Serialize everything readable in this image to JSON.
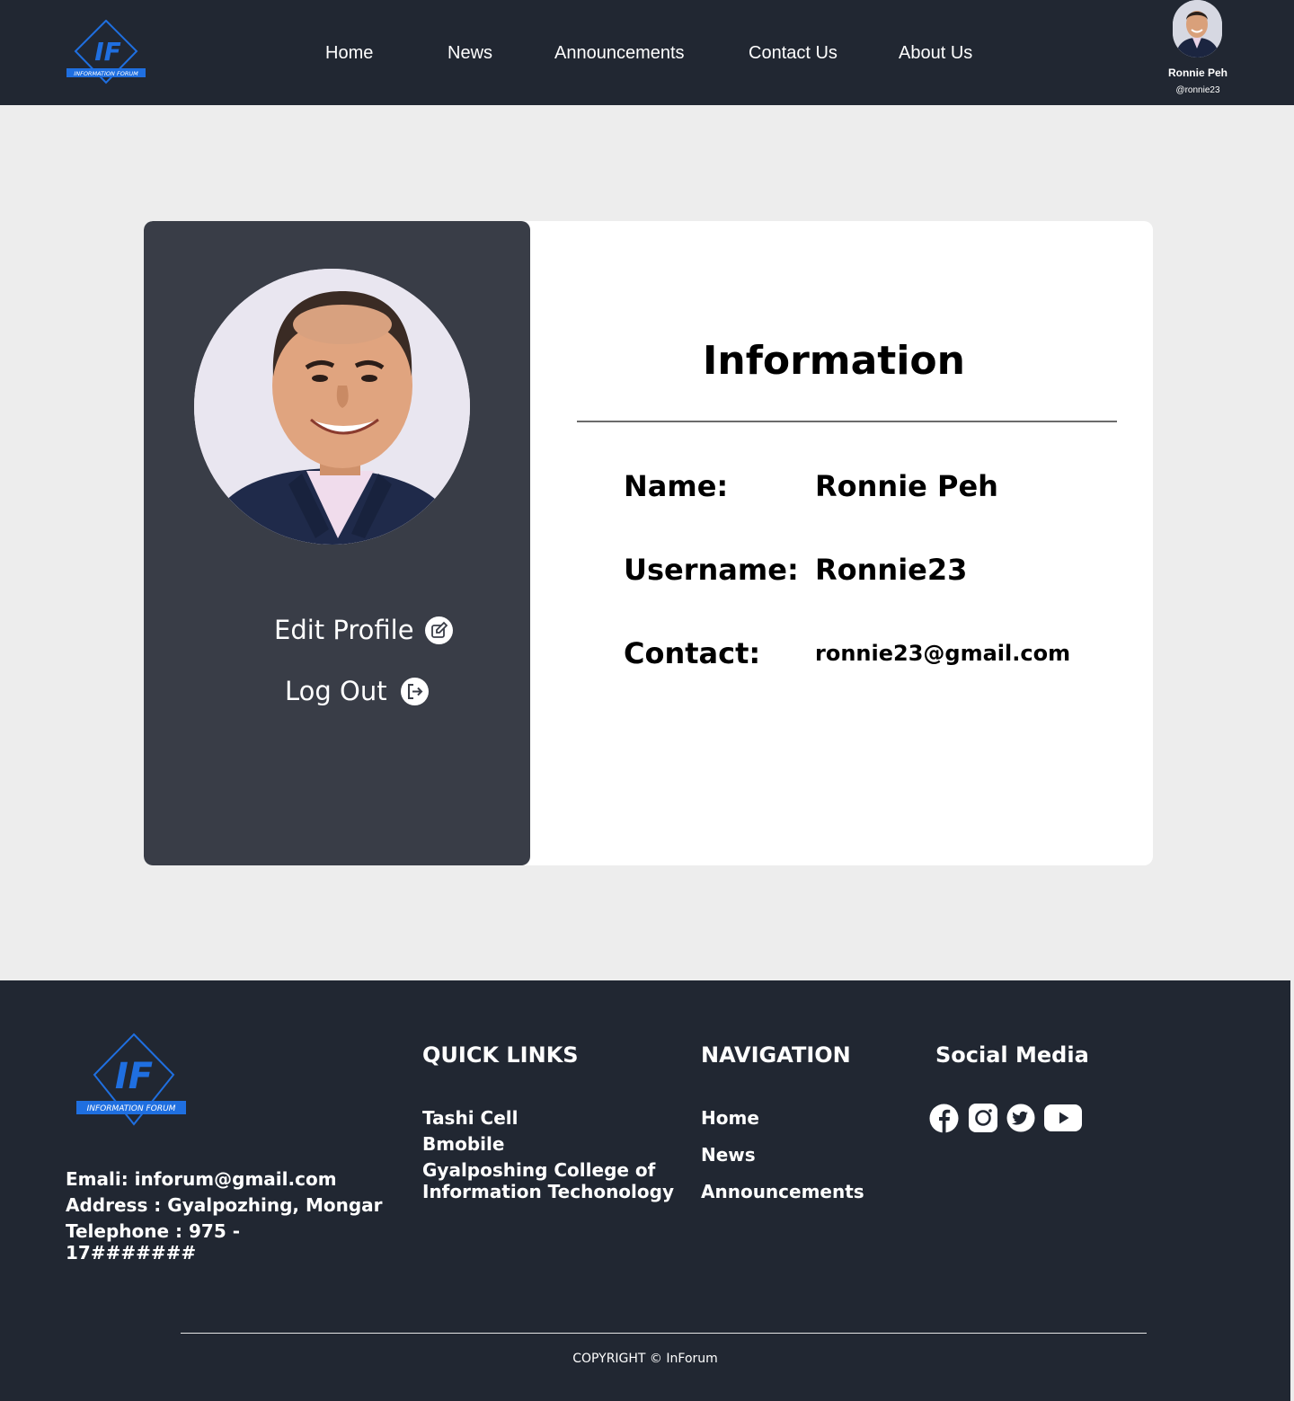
{
  "header": {
    "logo_text": "INFORMATION FORUM",
    "logo_monogram": "IF",
    "nav": [
      "Home",
      "News",
      "Announcements",
      "Contact Us",
      "About Us"
    ],
    "user": {
      "name": "Ronnie Peh",
      "handle": "@ronnie23"
    }
  },
  "profile": {
    "actions": {
      "edit": "Edit Profile",
      "logout": "Log Out"
    },
    "info_title": "Information",
    "fields": [
      {
        "label": "Name:",
        "value": "Ronnie Peh"
      },
      {
        "label": "Username:",
        "value": "Ronnie23"
      },
      {
        "label": "Contact:",
        "value": "ronnie23@gmail.com"
      }
    ]
  },
  "footer": {
    "logo_text": "INFORMATION FORUM",
    "logo_monogram": "IF",
    "contact": {
      "email": "Emali:  inforum@gmail.com",
      "address": "Address : Gyalpozhing, Mongar",
      "telephone_line1": "Telephone : 975 -",
      "telephone_line2": "17#######"
    },
    "quick_links": {
      "heading": "QUICK LINKS",
      "items": [
        "Tashi Cell",
        "Bmobile",
        "Gyalposhing College of",
        "Information Techonology"
      ]
    },
    "navigation": {
      "heading": "NAVIGATION",
      "items": [
        "Home",
        "News",
        "Announcements"
      ]
    },
    "social": {
      "heading": "Social Media",
      "icons": [
        "facebook-icon",
        "instagram-icon",
        "twitter-icon",
        "youtube-icon"
      ]
    },
    "copyright": "COPYRIGHT  ©  InForum"
  },
  "colors": {
    "header_bg": "#212732",
    "page_bg": "#ededed",
    "card_left_bg": "#393d47",
    "logo_blue": "#1f6fe0"
  }
}
